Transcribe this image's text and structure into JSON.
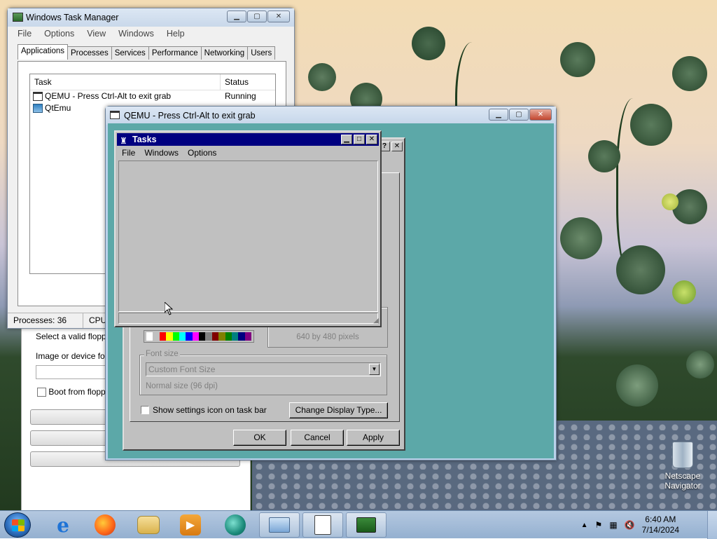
{
  "task_manager": {
    "title": "Windows Task Manager",
    "menu": [
      "File",
      "Options",
      "View",
      "Windows",
      "Help"
    ],
    "tabs": [
      "Applications",
      "Processes",
      "Services",
      "Performance",
      "Networking",
      "Users"
    ],
    "columns": {
      "task": "Task",
      "status": "Status"
    },
    "rows": [
      {
        "task": "QEMU - Press Ctrl-Alt to exit grab",
        "status": "Running"
      },
      {
        "task": "QtEmu",
        "status": ""
      }
    ],
    "status_bar": {
      "processes": "Processes: 36",
      "cpu": "CPU"
    }
  },
  "qtemu": {
    "floppy_label": "Select a valid floppy",
    "image_label": "Image or device for",
    "boot_label": "Boot from floppy"
  },
  "qemu": {
    "title": "QEMU - Press Ctrl-Alt to exit grab"
  },
  "display_dialog": {
    "resolution_text": "640 by 480 pixels",
    "font_size_label": "Font size",
    "font_size_value": "Custom Font Size",
    "font_size_note": "Normal size (96 dpi)",
    "show_icon_label": "Show settings icon on task bar",
    "change_display_button": "Change Display Type...",
    "ok_button": "OK",
    "cancel_button": "Cancel",
    "apply_button": "Apply",
    "palette": [
      "#ffffff",
      "#c0c0c0",
      "#ff0000",
      "#ffff00",
      "#00ff00",
      "#00ffff",
      "#0000ff",
      "#ff00ff",
      "#000000",
      "#808080",
      "#800000",
      "#808000",
      "#008000",
      "#008080",
      "#000080",
      "#800080"
    ]
  },
  "tasks_window": {
    "title": "Tasks",
    "menu": [
      "File",
      "Windows",
      "Options"
    ]
  },
  "taskbar": {
    "time": "6:40 AM",
    "date": "7/14/2024"
  },
  "desktop_icons": [
    {
      "label_line1": "Netscape",
      "label_line2": "Navigator"
    }
  ]
}
